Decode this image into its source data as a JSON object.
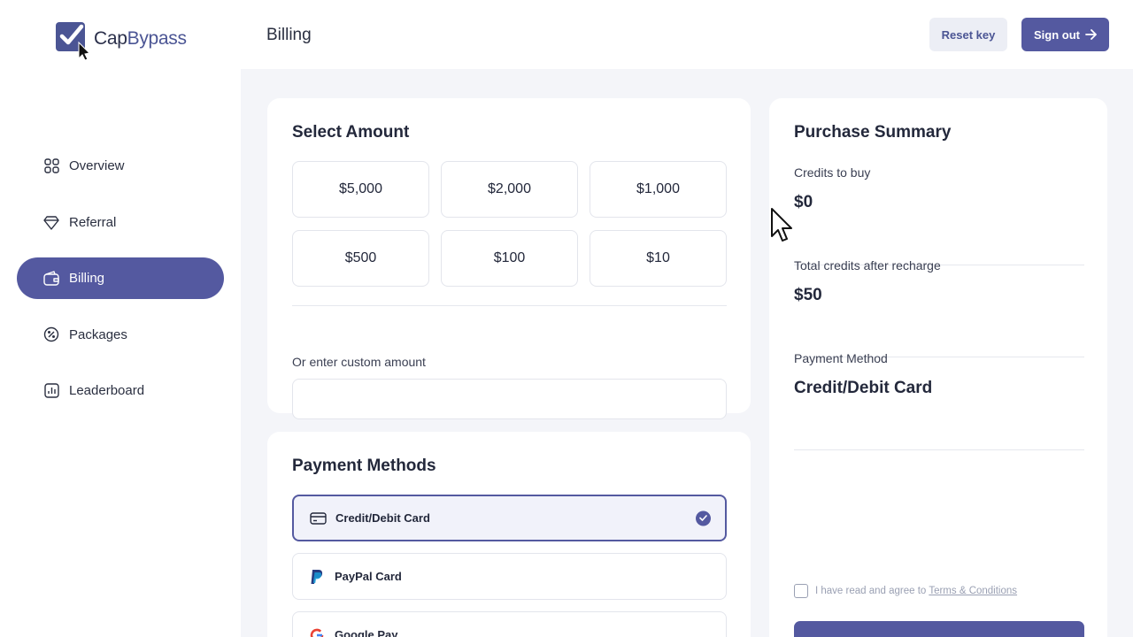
{
  "app": {
    "logo_text_part1": "Cap",
    "logo_text_part2": "Bypass"
  },
  "sidebar": {
    "items": [
      {
        "label": "Overview",
        "icon": "grid-icon",
        "active": false
      },
      {
        "label": "Referral",
        "icon": "diamond-icon",
        "active": false
      },
      {
        "label": "Billing",
        "icon": "wallet-icon",
        "active": true
      },
      {
        "label": "Packages",
        "icon": "percent-badge-icon",
        "active": false
      },
      {
        "label": "Leaderboard",
        "icon": "bar-chart-icon",
        "active": false
      }
    ]
  },
  "header": {
    "title": "Billing",
    "reset_label": "Reset key",
    "signout_label": "Sign out"
  },
  "select_amount": {
    "title": "Select Amount",
    "amounts": [
      "$5,000",
      "$2,000",
      "$1,000",
      "$500",
      "$100",
      "$10"
    ],
    "custom_label": "Or enter custom amount",
    "custom_value": ""
  },
  "payment_methods": {
    "title": "Payment Methods",
    "options": [
      {
        "label": "Credit/Debit Card",
        "icon": "card-icon",
        "selected": true
      },
      {
        "label": "PayPal Card",
        "icon": "paypal-icon",
        "selected": false
      },
      {
        "label": "Google Pay",
        "icon": "google-icon",
        "selected": false
      }
    ]
  },
  "summary": {
    "title": "Purchase Summary",
    "credits_label": "Credits to buy",
    "credits_value": "$0",
    "total_label": "Total credits after recharge",
    "total_value": "$50",
    "method_label": "Payment Method",
    "method_value": "Credit/Debit Card",
    "terms_text": "I have read and agree to",
    "terms_link": "Terms & Conditions",
    "terms_checked": false
  },
  "colors": {
    "accent": "#5459a0",
    "background": "#f4f5f9"
  }
}
